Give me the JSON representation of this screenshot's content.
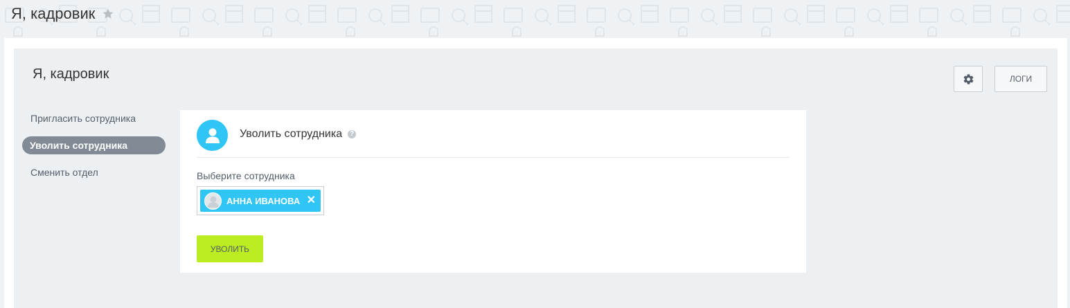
{
  "header": {
    "title": "Я, кадровик",
    "star_icon": "star-icon"
  },
  "panel": {
    "title": "Я, кадровик",
    "settings_icon": "gear-icon",
    "logs_label": "логи"
  },
  "sidebar": {
    "items": [
      {
        "label": "Пригласить сотрудника",
        "active": false
      },
      {
        "label": "Уволить сотрудника",
        "active": true
      },
      {
        "label": "Сменить отдел",
        "active": false
      }
    ]
  },
  "content": {
    "title": "Уволить сотрудника",
    "help_icon": "question-icon",
    "field_label": "Выберите сотрудника",
    "selected_employee": "АННА ИВАНОВА",
    "remove_icon": "close-icon",
    "submit_label": "уволить"
  },
  "colors": {
    "accent_blue": "#2fc6f6",
    "active_nav": "#828b95",
    "submit_green": "#bbed21",
    "panel_bg": "#edf0f3"
  }
}
